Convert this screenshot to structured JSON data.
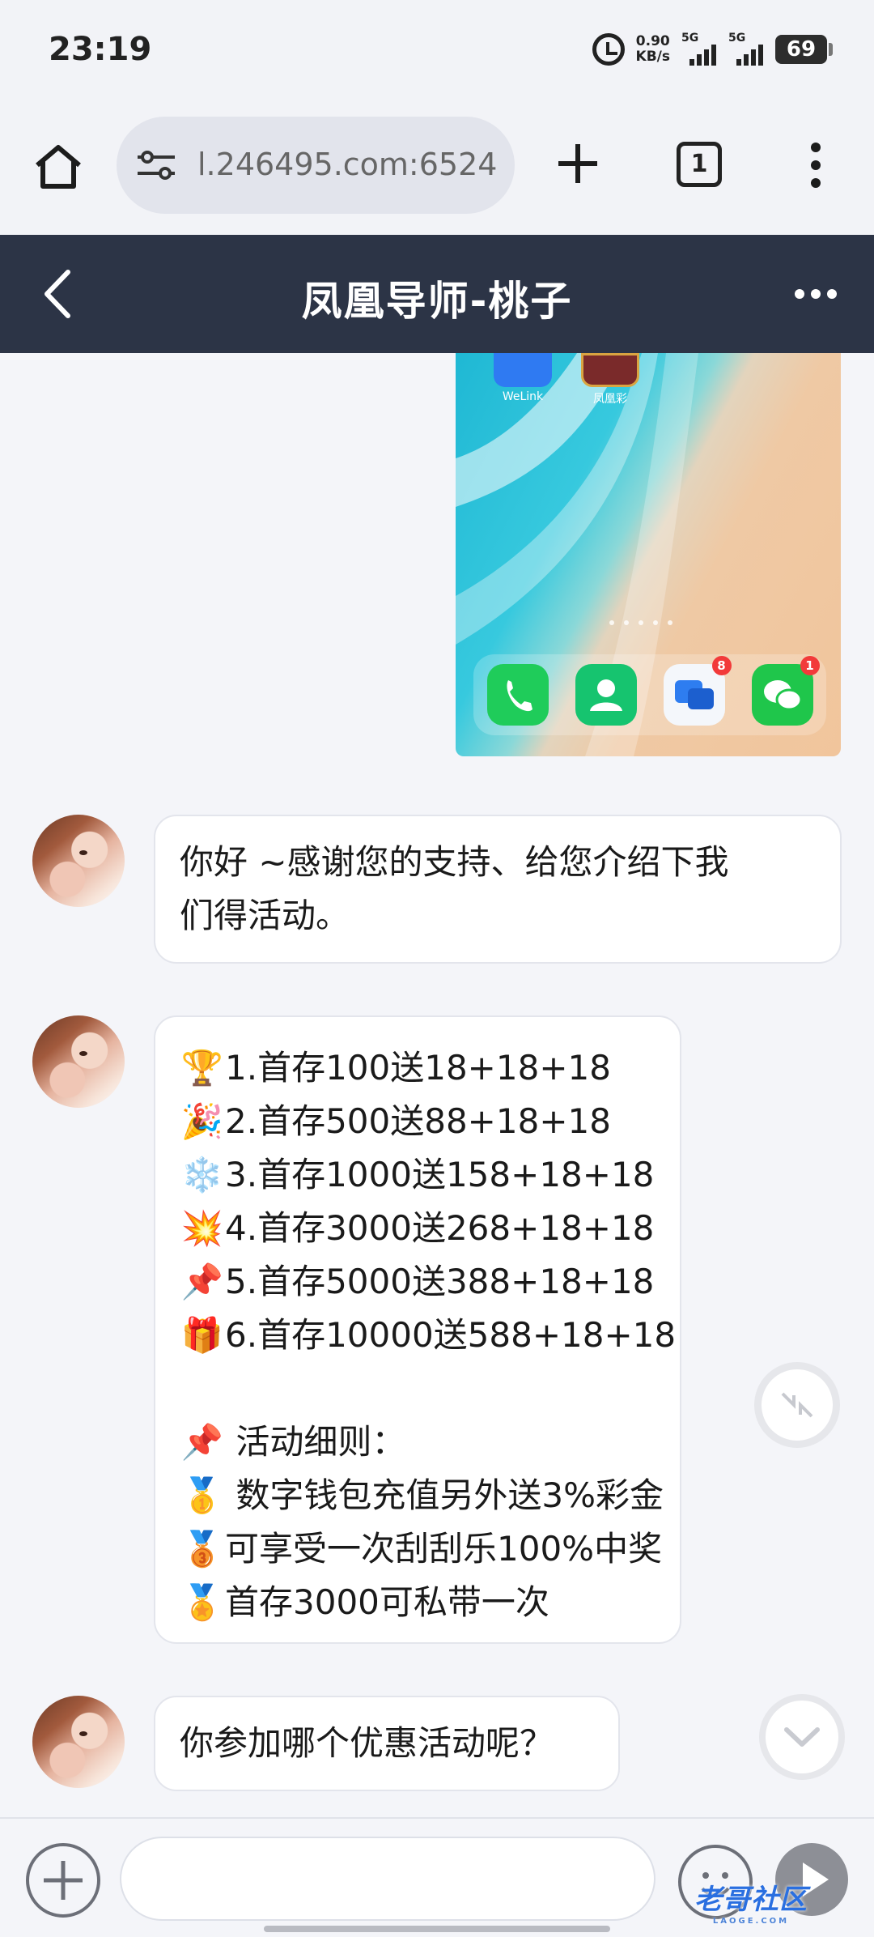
{
  "status_bar": {
    "time": "23:19",
    "net_speed_value": "0.90",
    "net_speed_unit": "KB/s",
    "sim1_label": "5G",
    "sim2_label": "5G",
    "battery": "69"
  },
  "browser": {
    "url": "l.246495.com:6524",
    "tab_count": "1"
  },
  "chat_header": {
    "title": "凤凰导师-桃子"
  },
  "shared_image": {
    "top_apps": [
      "WeLink",
      "凤凰彩"
    ],
    "dock_badges": {
      "messages": "8",
      "wechat": "1"
    }
  },
  "messages": [
    {
      "sender": "凤凰导师-桃子",
      "lines": [
        "你好 ~感谢您的支持、给您介绍下我",
        "们得活动。"
      ]
    },
    {
      "sender": "凤凰导师-桃子",
      "lines": [
        {
          "emoji": "🏆",
          "text": "1.首存100送18+18+18"
        },
        {
          "emoji": "🎉",
          "text": "2.首存500送88+18+18"
        },
        {
          "emoji": "❄️",
          "text": "3.首存1000送158+18+18"
        },
        {
          "emoji": "💥",
          "text": "4.首存3000送268+18+18"
        },
        {
          "emoji": "📌",
          "text": "5.首存5000送388+18+18"
        },
        {
          "emoji": "🎁",
          "text": "6.首存10000送588+18+18"
        },
        {
          "emoji": "",
          "text": ""
        },
        {
          "emoji": "📌",
          "text": " 活动细则："
        },
        {
          "emoji": "🥇",
          "text": " 数字钱包充值另外送3%彩金"
        },
        {
          "emoji": "🥉",
          "text": "可享受一次刮刮乐100%中奖"
        },
        {
          "emoji": "🏅",
          "text": "首存3000可私带一次"
        }
      ]
    },
    {
      "sender": "凤凰导师-桃子",
      "lines": [
        "你参加哪个优惠活动呢？"
      ]
    }
  ],
  "input_bar": {
    "message_value": "",
    "message_placeholder": ""
  },
  "watermark": {
    "text": "老哥社区",
    "sub": "LAOGE.COM"
  },
  "colors": {
    "header_bg": "#2c3446",
    "page_bg": "#f4f5f9",
    "bubble_bg": "#ffffff"
  }
}
